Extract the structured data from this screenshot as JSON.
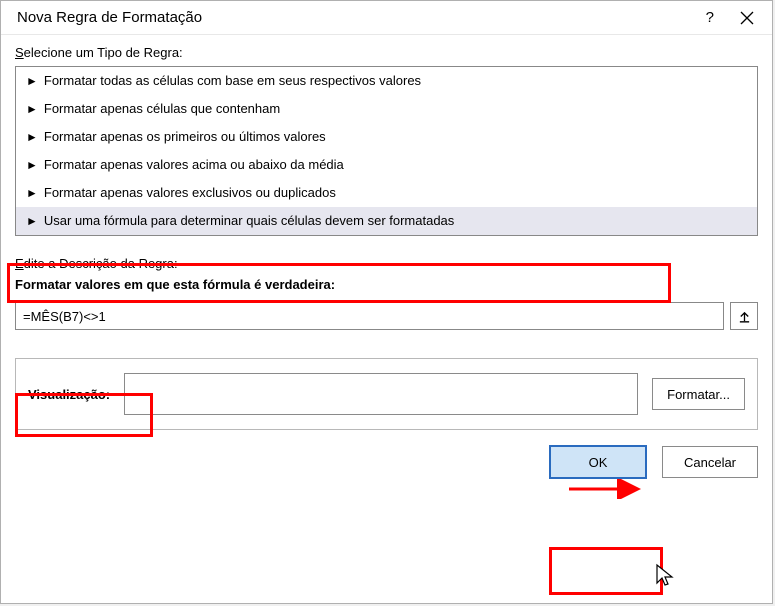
{
  "dialog": {
    "title": "Nova Regra de Formatação",
    "help_tooltip": "?",
    "close_tooltip": "Fechar"
  },
  "rule_type": {
    "label_prefix_ul": "S",
    "label_rest": "elecione um Tipo de Regra:",
    "items": [
      "Formatar todas as células com base em seus respectivos valores",
      "Formatar apenas células que contenham",
      "Formatar apenas os primeiros ou últimos valores",
      "Formatar apenas valores acima ou abaixo da média",
      "Formatar apenas valores exclusivos ou duplicados",
      "Usar uma fórmula para determinar quais células devem ser formatadas"
    ],
    "selected_index": 5
  },
  "rule_desc": {
    "label_prefix_ul": "E",
    "label_rest": "dite a Descrição da Regra:",
    "formula_label": "Formatar valores em que esta fórmula é verdadeira:",
    "formula_value": "=MÊS(B7)<>1"
  },
  "preview": {
    "label": "Visualização:",
    "format_button": "Formatar..."
  },
  "buttons": {
    "ok": "OK",
    "cancel": "Cancelar"
  }
}
